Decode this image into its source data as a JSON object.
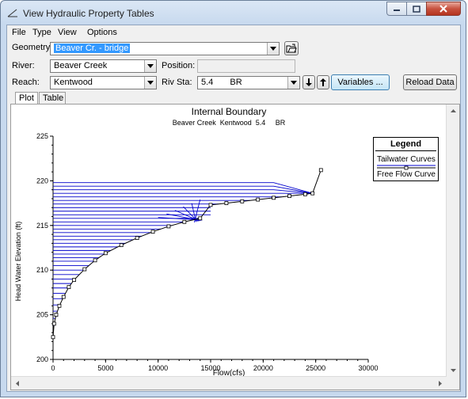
{
  "window": {
    "title": "View Hydraulic Property Tables"
  },
  "menu": [
    "File",
    "Type",
    "View",
    "Options"
  ],
  "geometry": {
    "label": "Geometry:",
    "value": "Beaver Cr. - bridge"
  },
  "river": {
    "label": "River:",
    "value": "Beaver Creek"
  },
  "position": {
    "label": "Position:",
    "value": ""
  },
  "reach": {
    "label": "Reach:",
    "value": "Kentwood"
  },
  "rivsta": {
    "label": "Riv Sta:",
    "value": "5.4",
    "suffix": "BR"
  },
  "buttons": {
    "variables": "Variables ...",
    "reload": "Reload Data"
  },
  "tabs": [
    "Plot",
    "Table"
  ],
  "colors": {
    "tailwater": "#0000cc",
    "free_flow": "#000000",
    "selection": "#3399ff"
  },
  "chart_data": {
    "type": "line",
    "title": "Internal Boundary",
    "subtitle": "Beaver Creek  Kentwood  5.4     BR",
    "xlabel": "Flow(cfs)",
    "ylabel": "Head Water Elevation (ft)",
    "xlim": [
      0,
      30000
    ],
    "ylim": [
      200,
      225
    ],
    "xticks": [
      "0",
      "5000",
      "10000",
      "15000",
      "20000",
      "25000",
      "30000"
    ],
    "yticks": [
      "200",
      "205",
      "210",
      "215",
      "220",
      "225"
    ],
    "legend": {
      "title": "Legend",
      "position": "top-right",
      "items": [
        "Tailwater Curves",
        "Free Flow Curve"
      ]
    },
    "series": [
      {
        "name": "Free Flow Curve",
        "x": [
          0,
          100,
          300,
          600,
          1000,
          1500,
          2000,
          3000,
          4000,
          5000,
          6500,
          8000,
          9500,
          11000,
          12500,
          14000,
          15000,
          16500,
          18000,
          19500,
          21000,
          22500,
          24000,
          24700,
          25500
        ],
        "y": [
          202.5,
          204.0,
          205.0,
          206.0,
          207.0,
          208.1,
          208.9,
          210.1,
          211.1,
          211.9,
          212.8,
          213.6,
          214.3,
          214.9,
          215.4,
          215.8,
          217.3,
          217.5,
          217.7,
          217.9,
          218.1,
          218.3,
          218.5,
          218.6,
          221.2
        ]
      },
      {
        "name": "Tailwater Curves",
        "levels": [
          203.8,
          204.6,
          205.4,
          206.1,
          206.8,
          207.4,
          208.0,
          208.5,
          209.0,
          209.5,
          210.0,
          210.5,
          211.0,
          211.4,
          211.8,
          212.2,
          212.6,
          213.0,
          213.4,
          213.8,
          214.2,
          214.6,
          215.0,
          215.4,
          215.8,
          216.2,
          216.6,
          217.0,
          217.4,
          217.8,
          218.2,
          218.6,
          219.0,
          219.4,
          219.8
        ]
      }
    ]
  }
}
